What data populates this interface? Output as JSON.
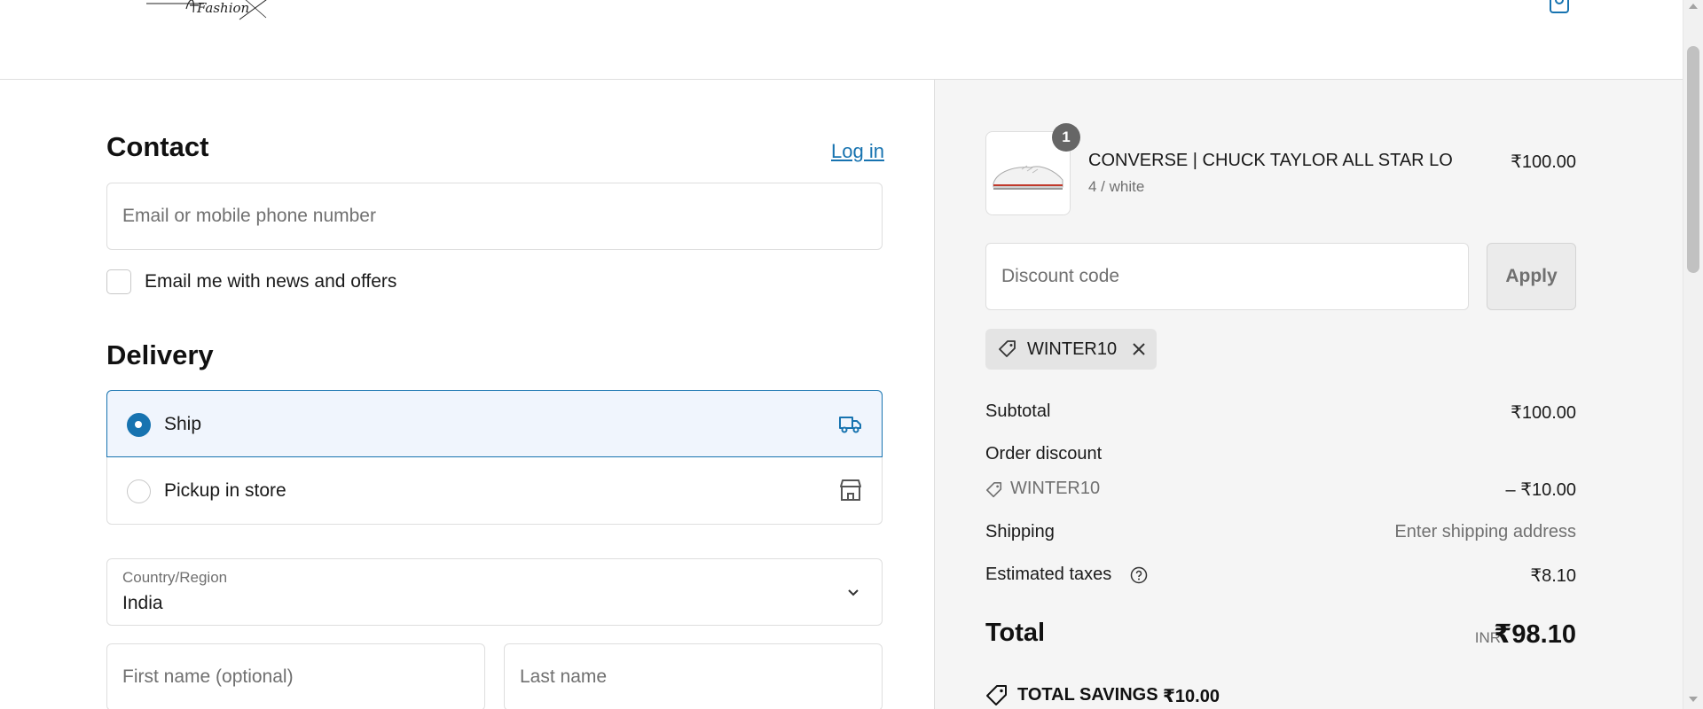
{
  "header": {
    "logo_text": "Fashion",
    "cart_icon": "shopping-bag-icon"
  },
  "contact": {
    "title": "Contact",
    "login_label": "Log in",
    "email_placeholder": "Email or mobile phone number",
    "email_value": "",
    "newsletter_label": "Email me with news and offers",
    "newsletter_checked": false
  },
  "delivery": {
    "title": "Delivery",
    "options": [
      {
        "label": "Ship",
        "icon": "truck-icon",
        "selected": true
      },
      {
        "label": "Pickup in store",
        "icon": "store-icon",
        "selected": false
      }
    ],
    "country_label": "Country/Region",
    "country_value": "India",
    "first_name_placeholder": "First name (optional)",
    "last_name_placeholder": "Last name"
  },
  "summary": {
    "product": {
      "quantity": "1",
      "name": "CONVERSE | CHUCK TAYLOR ALL STAR LO",
      "variant": "4 / white",
      "price": "₹100.00"
    },
    "discount_placeholder": "Discount code",
    "apply_label": "Apply",
    "applied_code": "WINTER10",
    "rows": {
      "subtotal_label": "Subtotal",
      "subtotal_value": "₹100.00",
      "order_discount_label": "Order discount",
      "discount_code": "WINTER10",
      "discount_value": "– ₹10.00",
      "shipping_label": "Shipping",
      "shipping_value": "Enter shipping address",
      "taxes_label": "Estimated taxes",
      "taxes_value": "₹8.10"
    },
    "total_label": "Total",
    "total_currency": "INR",
    "total_value": "₹98.10",
    "savings_label": "TOTAL SAVINGS",
    "savings_value": "₹10.00"
  },
  "colors": {
    "accent": "#1773b0",
    "selected_bg": "#f0f5fd",
    "summary_bg": "#f5f5f5"
  }
}
